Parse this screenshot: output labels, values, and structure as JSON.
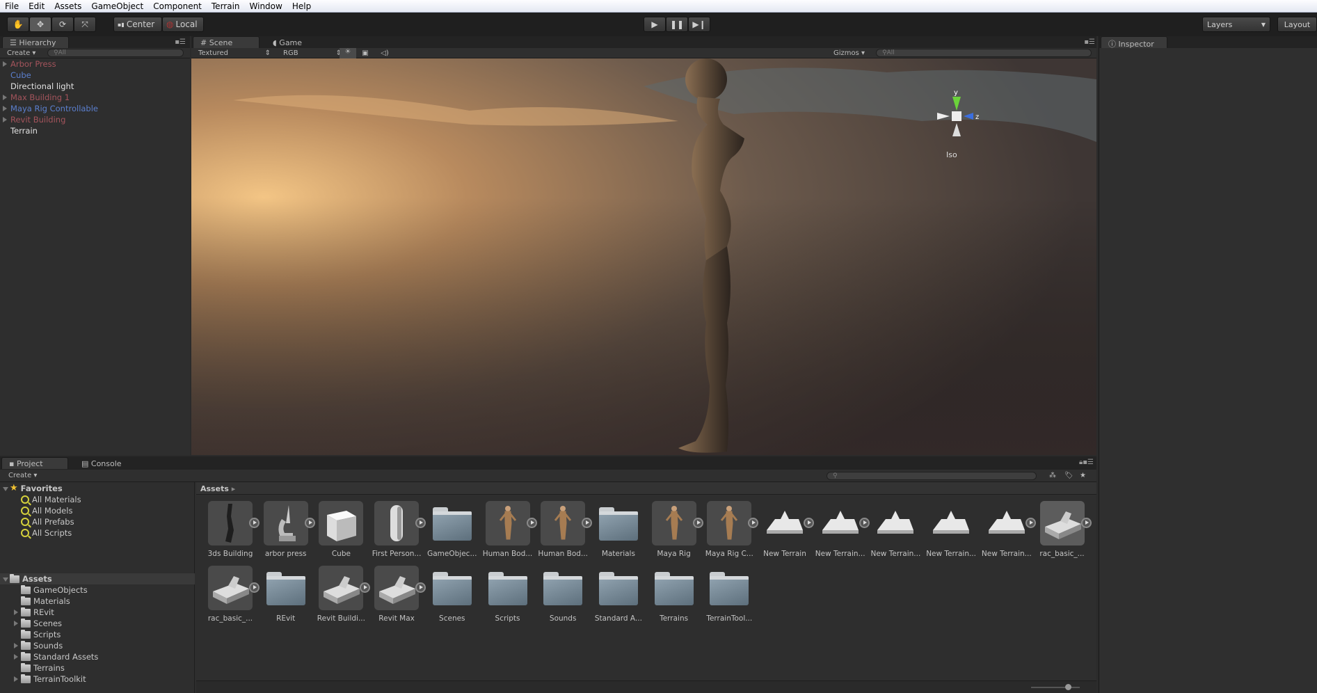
{
  "menu": [
    "File",
    "Edit",
    "Assets",
    "GameObject",
    "Component",
    "Terrain",
    "Window",
    "Help"
  ],
  "toolbar": {
    "tools": [
      "hand-icon",
      "move-icon",
      "rotate-icon",
      "scale-icon"
    ],
    "pivot_label": "Center",
    "space_label": "Local",
    "layers_label": "Layers",
    "layout_label": "Layout"
  },
  "hierarchy": {
    "tab": "Hierarchy",
    "create": "Create",
    "search_placeholder": "All",
    "items": [
      {
        "label": "Arbor Press",
        "color": "#a4545c",
        "expandable": true
      },
      {
        "label": "Cube",
        "color": "#5b7fce",
        "expandable": false
      },
      {
        "label": "Directional light",
        "color": "#e2e2e2",
        "expandable": false
      },
      {
        "label": "Max Building 1",
        "color": "#a4545c",
        "expandable": true
      },
      {
        "label": "Maya Rig Controllable",
        "color": "#5b7fce",
        "expandable": true
      },
      {
        "label": "Revit Building",
        "color": "#a4545c",
        "expandable": true
      },
      {
        "label": "Terrain",
        "color": "#e2e2e2",
        "expandable": false
      }
    ]
  },
  "scene": {
    "tabs": [
      "Scene",
      "Game"
    ],
    "render_mode": "Textured",
    "channel": "RGB",
    "gizmos": "Gizmos",
    "search_placeholder": "All",
    "axes": {
      "y": "y",
      "z": "z"
    },
    "projection": "Iso"
  },
  "inspector": {
    "tab": "Inspector"
  },
  "project": {
    "tabs": [
      "Project",
      "Console"
    ],
    "create": "Create",
    "favorites": {
      "label": "Favorites",
      "items": [
        "All Materials",
        "All Models",
        "All Prefabs",
        "All Scripts"
      ]
    },
    "assets_root": "Assets",
    "folders": [
      {
        "label": "GameObjects",
        "expandable": false
      },
      {
        "label": "Materials",
        "expandable": false
      },
      {
        "label": "REvit",
        "expandable": true
      },
      {
        "label": "Scenes",
        "expandable": true
      },
      {
        "label": "Scripts",
        "expandable": false
      },
      {
        "label": "Sounds",
        "expandable": true
      },
      {
        "label": "Standard Assets",
        "expandable": true
      },
      {
        "label": "Terrains",
        "expandable": false
      },
      {
        "label": "TerrainToolkit",
        "expandable": true
      }
    ],
    "breadcrumb": "Assets",
    "grid": [
      [
        {
          "label": "3ds Building",
          "kind": "building",
          "arrow": true
        },
        {
          "label": "arbor press",
          "kind": "press",
          "arrow": true
        },
        {
          "label": "Cube",
          "kind": "cube",
          "arrow": false
        },
        {
          "label": "First Person...",
          "kind": "capsule",
          "arrow": true
        },
        {
          "label": "GameObjec...",
          "kind": "folder",
          "arrow": false
        },
        {
          "label": "Human Bod...",
          "kind": "human",
          "arrow": true
        },
        {
          "label": "Human Bod...",
          "kind": "human",
          "arrow": true
        },
        {
          "label": "Materials",
          "kind": "folder",
          "arrow": false
        },
        {
          "label": "Maya Rig",
          "kind": "human",
          "arrow": true
        },
        {
          "label": "Maya Rig C...",
          "kind": "human",
          "arrow": true
        },
        {
          "label": "New Terrain",
          "kind": "terrain",
          "arrow": true
        },
        {
          "label": "New Terrain...",
          "kind": "terrain",
          "arrow": true
        },
        {
          "label": "New Terrain...",
          "kind": "terrain",
          "arrow": false
        },
        {
          "label": "New Terrain...",
          "kind": "terrain",
          "arrow": false
        },
        {
          "label": "New Terrain...",
          "kind": "terrain",
          "arrow": true
        },
        {
          "label": "rac_basic_...",
          "kind": "rac",
          "arrow": true,
          "selected": true
        }
      ],
      [
        {
          "label": "rac_basic_...",
          "kind": "rac",
          "arrow": true
        },
        {
          "label": "REvit",
          "kind": "folder",
          "arrow": false
        },
        {
          "label": "Revit Buildi...",
          "kind": "rac",
          "arrow": true
        },
        {
          "label": "Revit Max",
          "kind": "rac",
          "arrow": true
        },
        {
          "label": "Scenes",
          "kind": "folder",
          "arrow": false
        },
        {
          "label": "Scripts",
          "kind": "folder",
          "arrow": false
        },
        {
          "label": "Sounds",
          "kind": "folder",
          "arrow": false
        },
        {
          "label": "Standard A...",
          "kind": "folder",
          "arrow": false
        },
        {
          "label": "Terrains",
          "kind": "folder",
          "arrow": false
        },
        {
          "label": "TerrainTool...",
          "kind": "folder",
          "arrow": false
        }
      ]
    ]
  }
}
